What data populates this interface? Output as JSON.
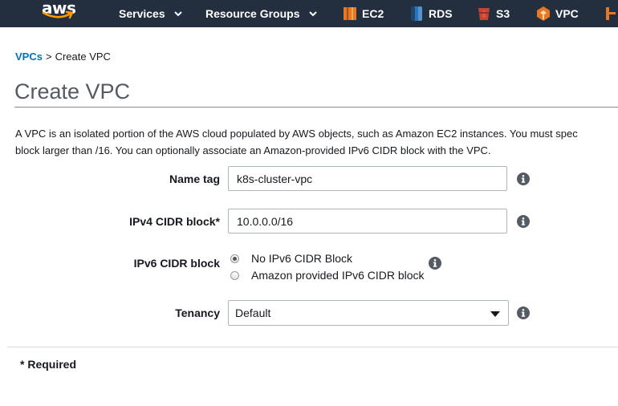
{
  "nav": {
    "logo": "aws",
    "services_label": "Services",
    "resource_groups_label": "Resource Groups",
    "shortcuts": [
      {
        "label": "EC2",
        "icon": "ec2-icon",
        "color": "#e87723"
      },
      {
        "label": "RDS",
        "icon": "rds-icon",
        "color": "#2e73b8"
      },
      {
        "label": "S3",
        "icon": "s3-icon",
        "color": "#c7442e"
      },
      {
        "label": "VPC",
        "icon": "vpc-icon",
        "color": "#e87723"
      }
    ]
  },
  "breadcrumb": {
    "parent": "VPCs",
    "separator": ">",
    "current": "Create VPC"
  },
  "page": {
    "title": "Create VPC",
    "description_line1": "A VPC is an isolated portion of the AWS cloud populated by AWS objects, such as Amazon EC2 instances. You must spec",
    "description_line2": "block larger than /16. You can optionally associate an Amazon-provided IPv6 CIDR block with the VPC."
  },
  "form": {
    "name_tag": {
      "label": "Name tag",
      "value": "k8s-cluster-vpc"
    },
    "ipv4_cidr": {
      "label": "IPv4 CIDR block*",
      "value": "10.0.0.0/16"
    },
    "ipv6_cidr": {
      "label": "IPv6 CIDR block",
      "options": [
        "No IPv6 CIDR Block",
        "Amazon provided IPv6 CIDR block"
      ],
      "selected": "No IPv6 CIDR Block"
    },
    "tenancy": {
      "label": "Tenancy",
      "value": "Default"
    },
    "required_note": "* Required"
  },
  "colors": {
    "nav_bg": "#232f3e",
    "link": "#0073bb",
    "title": "#545b64"
  }
}
